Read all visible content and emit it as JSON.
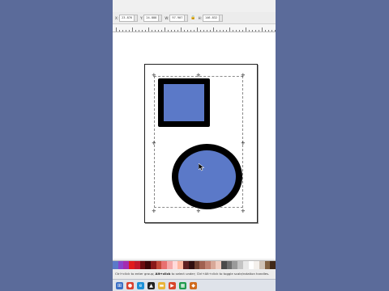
{
  "toolbar": {
    "x_label": "X:",
    "x_value": "23.876",
    "y_label": "Y:",
    "y_value": "24.888",
    "w_label": "W:",
    "w_value": "97.907",
    "h_label": "H:",
    "h_value": "146.832",
    "lock_symbol": "🔒"
  },
  "canvas": {
    "shape_fill": "#5b79c8",
    "shape_stroke": "#000000",
    "handle_glyph": "✛"
  },
  "palette": {
    "swatches": [
      "#5b79c8",
      "#8844cc",
      "#a42cb0",
      "#e01c1c",
      "#c0182a",
      "#6a0c10",
      "#3a0508",
      "#8a1a1a",
      "#c44a3a",
      "#e87070",
      "#f4a8a8",
      "#ffdada",
      "#ffb8a0",
      "#602020",
      "#301010",
      "#704030",
      "#a06050",
      "#c08070",
      "#d8a898",
      "#f0ccc0",
      "#4a4a4a",
      "#6e6e6e",
      "#9a9a9a",
      "#c4c4c4",
      "#e8e8e8",
      "#ffffff",
      "#f4f0ec",
      "#d0c4b8",
      "#806040",
      "#402818"
    ]
  },
  "statusbar": {
    "text_before": "Ctrl+click to enter group; ",
    "text_mid": "Alt+click",
    "text_after": " to select under; Ctrl+Alt+click to toggle scale/rotation handles."
  },
  "taskbar": {
    "icons": [
      {
        "name": "windows-icon",
        "color": "#3b6fc5",
        "glyph": "⊞"
      },
      {
        "name": "chrome-icon",
        "color": "#d9412f",
        "glyph": "●"
      },
      {
        "name": "edge-icon",
        "color": "#1b8fd6",
        "glyph": "e"
      },
      {
        "name": "inkscape-icon",
        "color": "#222222",
        "glyph": "▲"
      },
      {
        "name": "explorer-icon",
        "color": "#e9b43a",
        "glyph": "▬"
      },
      {
        "name": "media-icon",
        "color": "#d8442a",
        "glyph": "▶"
      },
      {
        "name": "sheets-icon",
        "color": "#1f9a4d",
        "glyph": "▦"
      },
      {
        "name": "app-icon",
        "color": "#d06a1c",
        "glyph": "◆"
      }
    ]
  }
}
